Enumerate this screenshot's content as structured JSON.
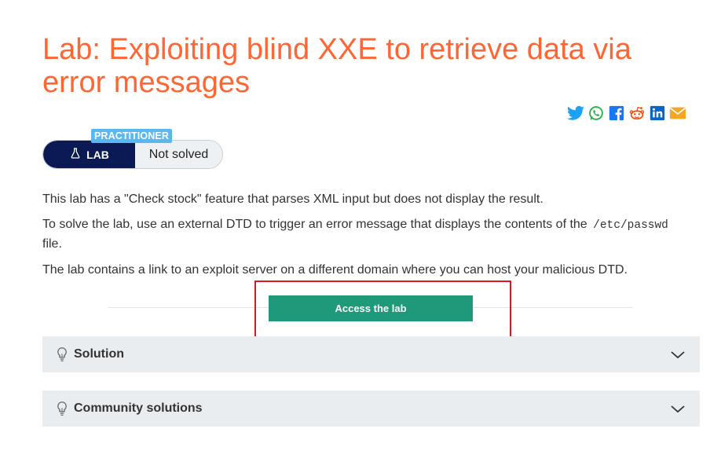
{
  "title": "Lab: Exploiting blind XXE to retrieve data via error messages",
  "level_badge": "PRACTITIONER",
  "lab_label": "LAB",
  "status": "Not solved",
  "share_icons": [
    "twitter-icon",
    "whatsapp-icon",
    "facebook-icon",
    "reddit-icon",
    "linkedin-icon",
    "email-icon"
  ],
  "description": {
    "p1": "This lab has a \"Check stock\" feature that parses XML input but does not display the result.",
    "p2_before": "To solve the lab, use an external DTD to trigger an error message that displays the contents of the",
    "p2_code": "/etc/passwd",
    "p2_after": "file.",
    "p3": "The lab contains a link to an exploit server on a different domain where you can host your malicious DTD."
  },
  "access_button": "Access the lab",
  "accordions": [
    {
      "label": "Solution"
    },
    {
      "label": "Community solutions"
    }
  ],
  "colors": {
    "title": "#ff6633",
    "practitioner": "#5ab8f0",
    "lab_pill": "#0b1a55",
    "access_button": "#1e9a7a",
    "highlight_box": "#e0161f"
  }
}
